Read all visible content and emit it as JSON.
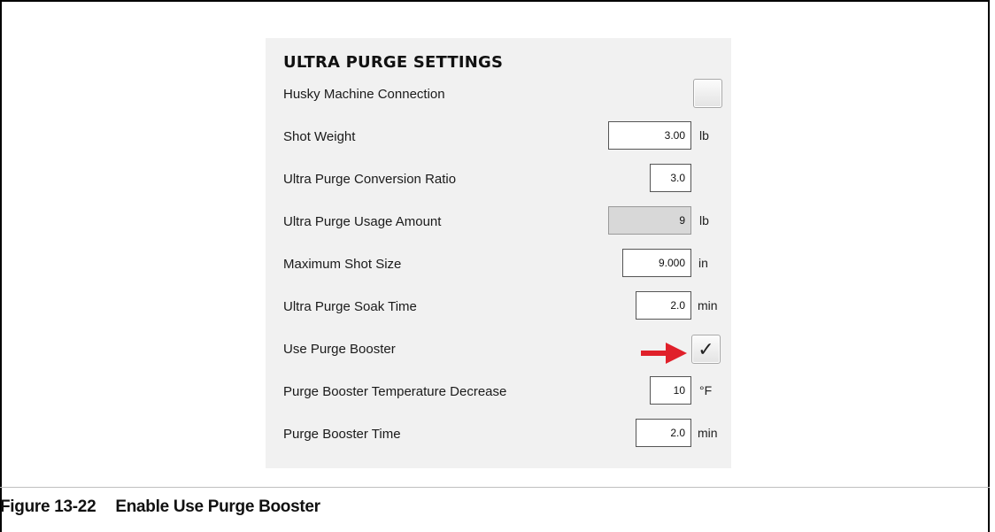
{
  "panel": {
    "title": "ULTRA PURGE SETTINGS",
    "rows": [
      {
        "label": "Husky Machine Connection"
      },
      {
        "label": "Shot Weight",
        "value": "3.00",
        "unit": "lb"
      },
      {
        "label": "Ultra Purge Conversion Ratio",
        "value": "3.0"
      },
      {
        "label": "Ultra Purge Usage Amount",
        "value": "9",
        "unit": "lb"
      },
      {
        "label": "Maximum Shot Size",
        "value": "9.000",
        "unit": "in"
      },
      {
        "label": "Ultra Purge Soak Time",
        "value": "2.0",
        "unit": "min"
      },
      {
        "label": "Use Purge Booster",
        "checked": true,
        "check_glyph": "✓"
      },
      {
        "label": "Purge Booster Temperature Decrease",
        "value": "10",
        "unit": "°F"
      },
      {
        "label": "Purge Booster Time",
        "value": "2.0",
        "unit": "min"
      }
    ]
  },
  "caption": {
    "number": "Figure 13-22",
    "text": "Enable Use Purge Booster"
  },
  "colors": {
    "arrow": "#e0202a",
    "panel_bg": "#f1f1f1",
    "readonly_bg": "#d8d8d8"
  },
  "icons": {
    "arrow": "right-arrow-icon",
    "check": "checkmark-icon"
  }
}
